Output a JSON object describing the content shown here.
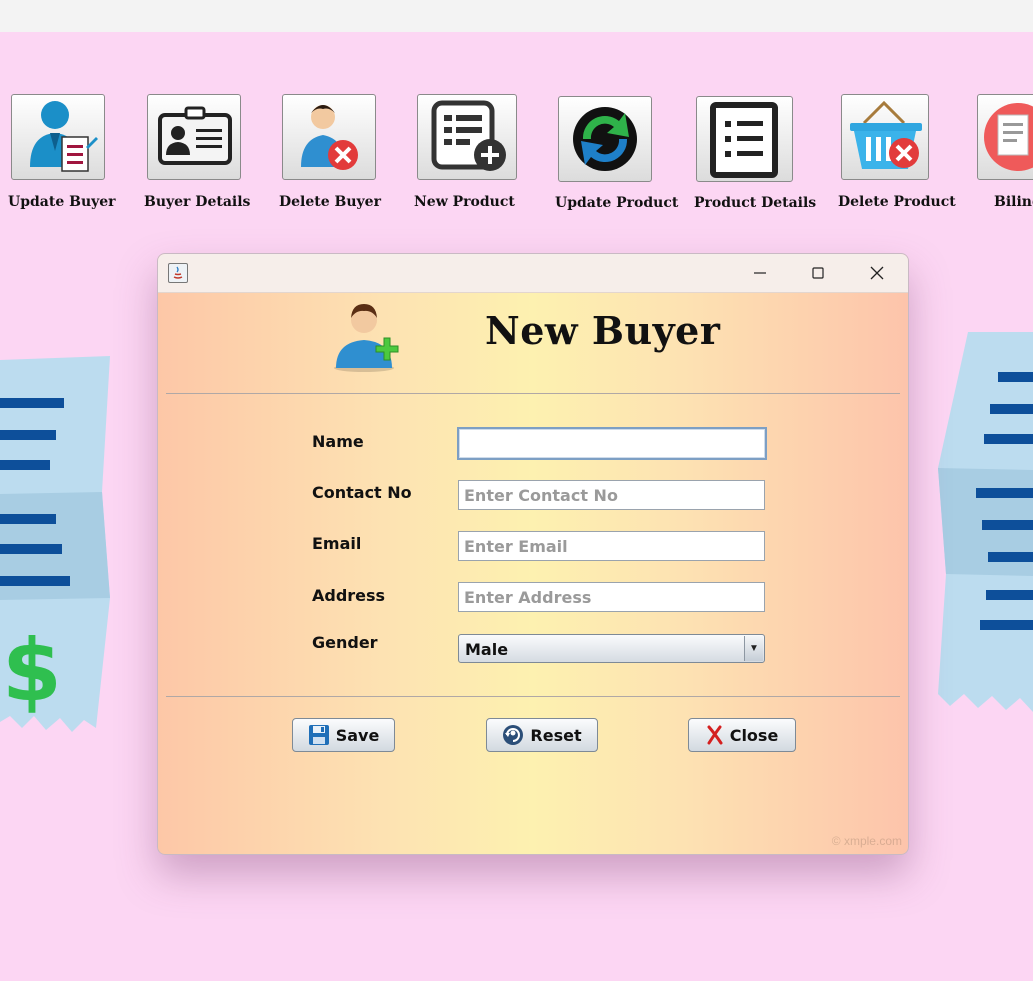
{
  "toolbar": {
    "items": [
      {
        "label": "Update Buyer",
        "icon": "update-buyer-icon"
      },
      {
        "label": "Buyer Details",
        "icon": "id-card-icon"
      },
      {
        "label": "Delete  Buyer",
        "icon": "delete-user-icon"
      },
      {
        "label": "New Product",
        "icon": "new-product-icon"
      },
      {
        "label": "Update Product",
        "icon": "refresh-icon"
      },
      {
        "label": "Product Details",
        "icon": "list-icon"
      },
      {
        "label": "Delete Product",
        "icon": "delete-basket-icon"
      },
      {
        "label": "Biling",
        "icon": "billing-icon"
      }
    ]
  },
  "dialog": {
    "title": "New Buyer",
    "form": {
      "name_label": "Name",
      "name_value": "",
      "contact_label": "Contact No",
      "contact_placeholder": "Enter Contact No",
      "email_label": "Email",
      "email_placeholder": "Enter Email",
      "address_label": "Address",
      "address_placeholder": "Enter Address",
      "gender_label": "Gender",
      "gender_value": "Male"
    },
    "buttons": {
      "save": "Save",
      "reset": "Reset",
      "close": "Close"
    },
    "watermark": "© xmple.com"
  },
  "colors": {
    "page_background": "#fcd6f3",
    "receipt_blue": "#bcdcef",
    "receipt_lines": "#0d4f9a",
    "dollar_green": "#2fbf4f"
  }
}
